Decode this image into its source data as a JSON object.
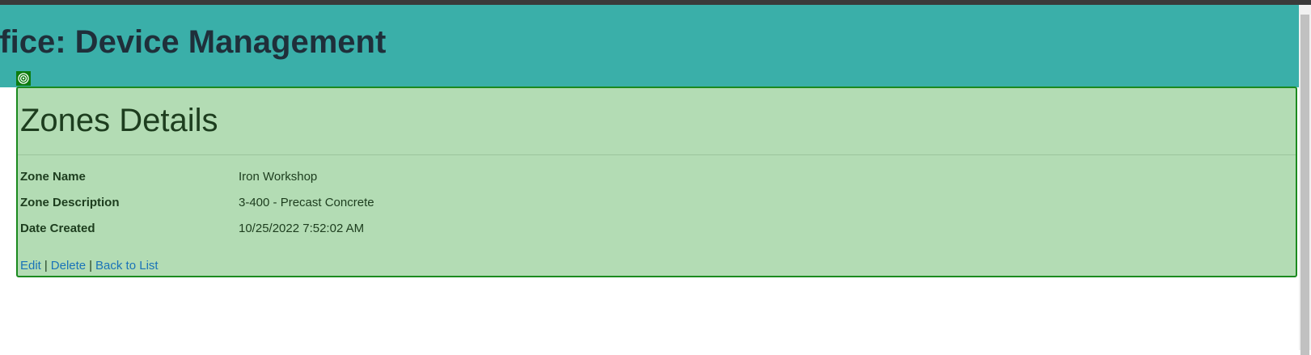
{
  "header": {
    "title": "ffice: Device Management"
  },
  "inspector": {
    "icon": "target-icon"
  },
  "details": {
    "title": "Zones Details",
    "fields": [
      {
        "label": "Zone Name",
        "value": "Iron Workshop"
      },
      {
        "label": "Zone Description",
        "value": "3-400 - Precast Concrete"
      },
      {
        "label": "Date Created",
        "value": "10/25/2022 7:52:02 AM"
      }
    ]
  },
  "actions": {
    "edit": "Edit",
    "delete": "Delete",
    "back": "Back to List",
    "separator": "|"
  },
  "colors": {
    "banner": "#3aafa9",
    "panel_highlight": "#b3dcb4",
    "panel_border": "#1b8a1f",
    "link": "#1a73b8"
  }
}
